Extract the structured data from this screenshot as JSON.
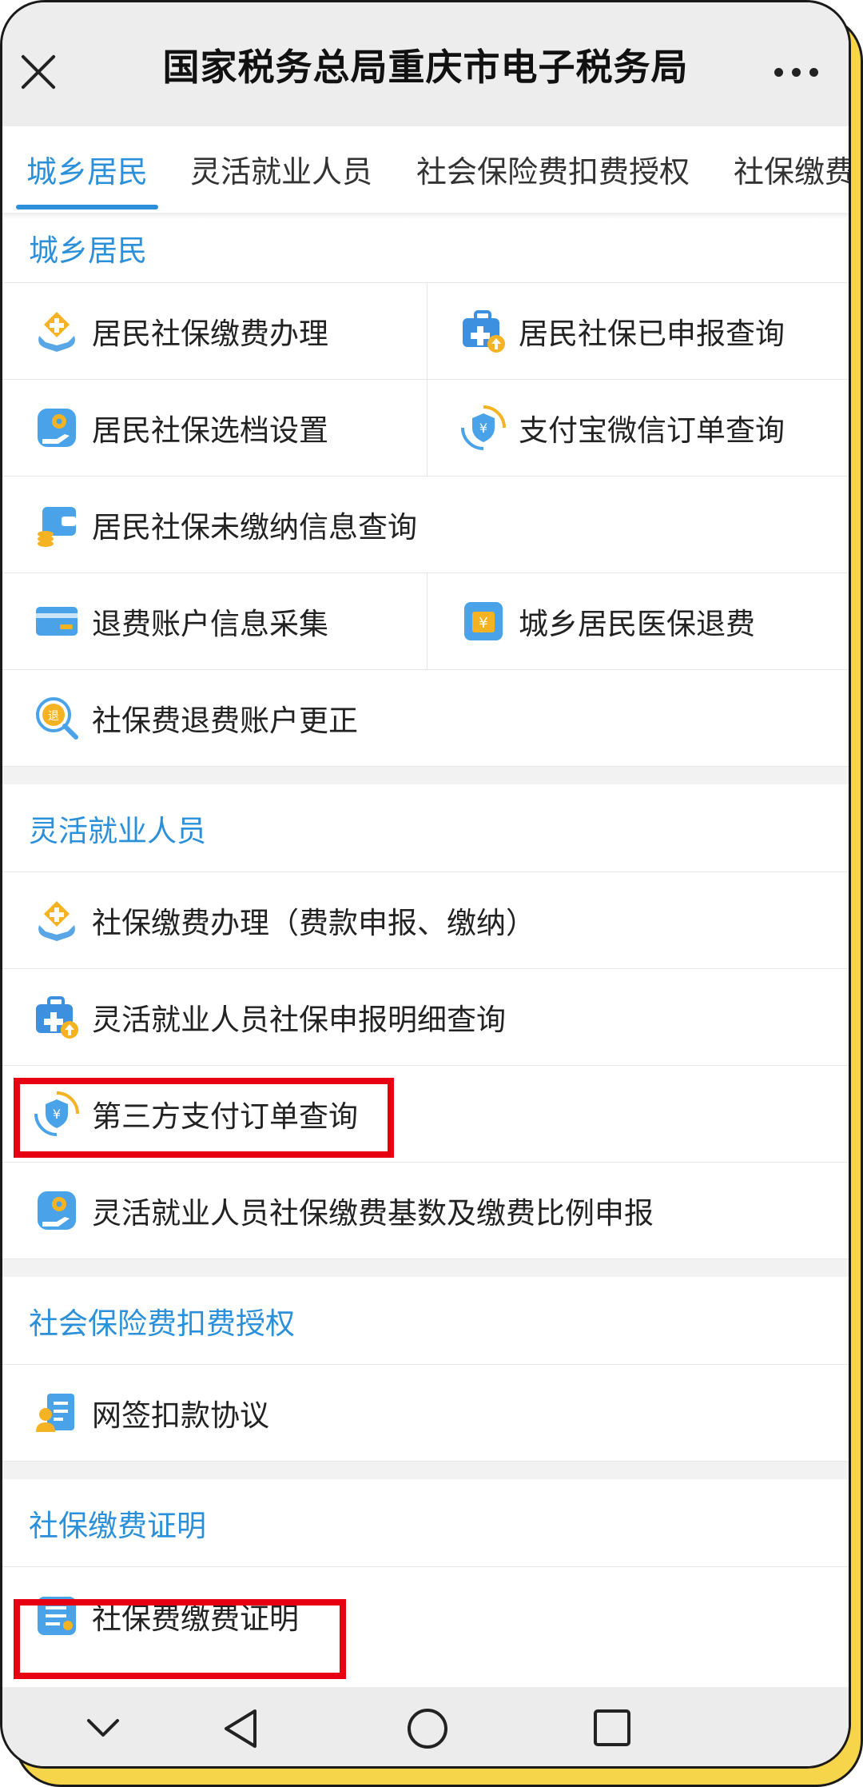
{
  "header": {
    "title": "国家税务总局重庆市电子税务局"
  },
  "tabs": [
    "城乡居民",
    "灵活就业人员",
    "社会保险费扣费授权",
    "社保缴费"
  ],
  "sections": {
    "residents": {
      "title": "城乡居民",
      "items": [
        "居民社保缴费办理",
        "居民社保已申报查询",
        "居民社保选档设置",
        "支付宝微信订单查询",
        "居民社保未缴纳信息查询",
        "退费账户信息采集",
        "城乡居民医保退费",
        "社保费退费账户更正"
      ]
    },
    "flexible": {
      "title": "灵活就业人员",
      "items": [
        "社保缴费办理（费款申报、缴纳）",
        "灵活就业人员社保申报明细查询",
        "第三方支付订单查询",
        "灵活就业人员社保缴费基数及缴费比例申报"
      ]
    },
    "authorization": {
      "title": "社会保险费扣费授权",
      "items": [
        "网签扣款协议"
      ]
    },
    "certificate": {
      "title": "社保缴费证明",
      "items": [
        "社保费缴费证明"
      ]
    }
  },
  "colors": {
    "accent": "#2b90d9",
    "highlight": "#e60012",
    "frame": "#f7d54a"
  },
  "icons": [
    "close-icon",
    "more-icon",
    "chevron-down-icon",
    "back-icon",
    "home-icon",
    "recents-icon"
  ]
}
